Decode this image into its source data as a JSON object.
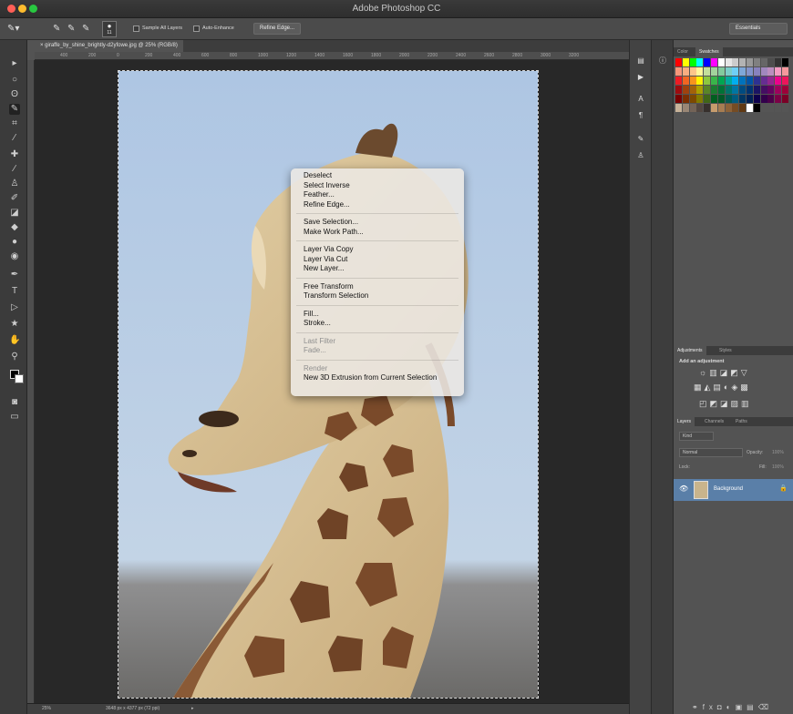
{
  "window": {
    "title": "Adobe Photoshop CC"
  },
  "options_bar": {
    "sample_all_layers": "Sample All Layers",
    "auto_enhance": "Auto-Enhance",
    "refine_edge": "Refine Edge...",
    "brush_size": "11",
    "workspace": "Essentials"
  },
  "document": {
    "tab_title": "giraffe_by_shine_brightly-d2yfowe.jpg @ 25% (RGB/8)",
    "ruler_ticks": [
      "400",
      "200",
      "0",
      "200",
      "400",
      "600",
      "800",
      "1000",
      "1200",
      "1400",
      "1600",
      "1800",
      "2000",
      "2200",
      "2400",
      "2600",
      "2800",
      "3000",
      "3200"
    ]
  },
  "status": {
    "zoom": "25%",
    "doc_size": "3648 px x 4377 px (72 ppi)"
  },
  "context_menu": {
    "groups": [
      [
        {
          "label": "Deselect",
          "enabled": true
        },
        {
          "label": "Select Inverse",
          "enabled": true
        },
        {
          "label": "Feather...",
          "enabled": true
        },
        {
          "label": "Refine Edge...",
          "enabled": true
        }
      ],
      [
        {
          "label": "Save Selection...",
          "enabled": true
        },
        {
          "label": "Make Work Path...",
          "enabled": true
        }
      ],
      [
        {
          "label": "Layer Via Copy",
          "enabled": true
        },
        {
          "label": "Layer Via Cut",
          "enabled": true
        },
        {
          "label": "New Layer...",
          "enabled": true
        }
      ],
      [
        {
          "label": "Free Transform",
          "enabled": true
        },
        {
          "label": "Transform Selection",
          "enabled": true
        }
      ],
      [
        {
          "label": "Fill...",
          "enabled": true
        },
        {
          "label": "Stroke...",
          "enabled": true
        }
      ],
      [
        {
          "label": "Last Filter",
          "enabled": false
        },
        {
          "label": "Fade...",
          "enabled": false
        }
      ],
      [
        {
          "label": "Render",
          "enabled": false
        },
        {
          "label": "New 3D Extrusion from Current Selection",
          "enabled": true
        }
      ]
    ]
  },
  "panels": {
    "color_tab": "Color",
    "swatches_tab": "Swatches",
    "adjustments_tab": "Adjustments",
    "styles_tab": "Styles",
    "add_adjustment": "Add an adjustment",
    "layers_tab": "Layers",
    "channels_tab": "Channels",
    "paths_tab": "Paths",
    "kind": "Kind",
    "blend_mode": "Normal",
    "opacity_label": "Opacity:",
    "opacity_value": "100%",
    "lock_label": "Lock:",
    "fill_label": "Fill:",
    "fill_value": "100%",
    "layer_name": "Background"
  },
  "colors": {
    "accent": "#5a7fa8",
    "menu_bg": "#ece8e4",
    "sky": "#b3cbe3"
  }
}
